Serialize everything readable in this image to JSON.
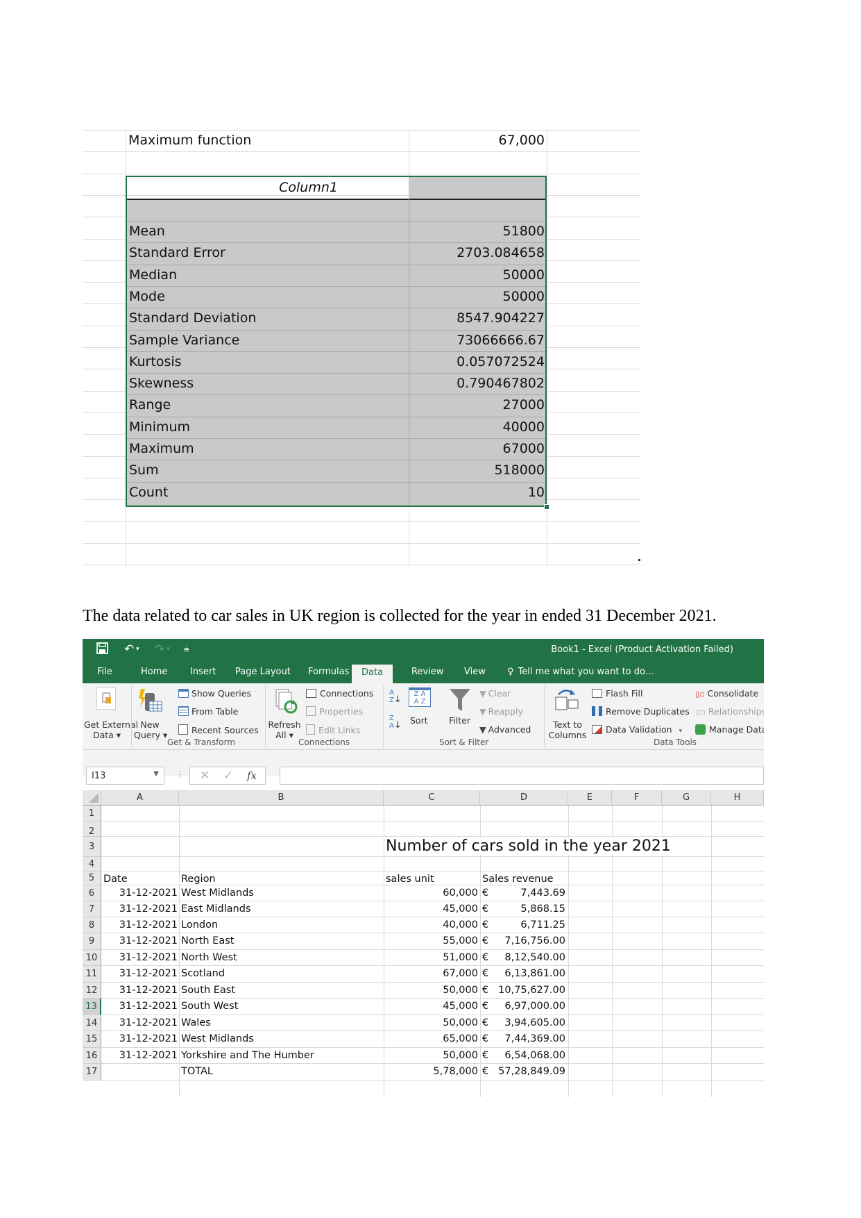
{
  "top_sheet": {
    "max_function": {
      "label": "Maximum function",
      "value": "67,000"
    },
    "stats_header": "Column1",
    "stats": [
      {
        "label": "Mean",
        "value": "51800"
      },
      {
        "label": "Standard Error",
        "value": "2703.084658"
      },
      {
        "label": "Median",
        "value": "50000"
      },
      {
        "label": "Mode",
        "value": "50000"
      },
      {
        "label": "Standard Deviation",
        "value": "8547.904227"
      },
      {
        "label": "Sample Variance",
        "value": "73066666.67"
      },
      {
        "label": "Kurtosis",
        "value": "0.057072524"
      },
      {
        "label": "Skewness",
        "value": "0.790467802"
      },
      {
        "label": "Range",
        "value": "27000"
      },
      {
        "label": "Minimum",
        "value": "40000"
      },
      {
        "label": "Maximum",
        "value": "67000"
      },
      {
        "label": "Sum",
        "value": "518000"
      },
      {
        "label": "Count",
        "value": "10"
      }
    ]
  },
  "caption": "The data related to car sales in UK region is collected for the year in ended 31 December 2021.",
  "excel": {
    "window_title": "Book1 - Excel (Product Activation Failed)",
    "quick_access": {
      "save": "save-icon",
      "undo": "undo-icon",
      "redo": "redo-icon",
      "customize": "customize-icon"
    },
    "tabs": [
      "File",
      "Home",
      "Insert",
      "Page Layout",
      "Formulas",
      "Data",
      "Review",
      "View"
    ],
    "active_tab": "Data",
    "tell_me": "Tell me what you want to do...",
    "ribbon": {
      "get_external_data": [
        "Get External",
        "Data ▾"
      ],
      "new_query": [
        "New",
        "Query ▾"
      ],
      "show_queries": "Show Queries",
      "from_table": "From Table",
      "recent_sources": "Recent Sources",
      "refresh_all": [
        "Refresh",
        "All ▾"
      ],
      "connections": "Connections",
      "properties": "Properties",
      "edit_links": "Edit Links",
      "sort": "Sort",
      "filter": "Filter",
      "clear": "Clear",
      "reapply": "Reapply",
      "advanced": "Advanced",
      "text_to_columns": [
        "Text to",
        "Columns"
      ],
      "flash_fill": "Flash Fill",
      "remove_duplicates": "Remove Duplicates",
      "data_validation": "Data Validation",
      "consolidate": "Consolidate",
      "relationships": "Relationships",
      "manage_data": "Manage Data",
      "groups": [
        "Get & Transform",
        "Connections",
        "Sort & Filter",
        "Data Tools"
      ]
    },
    "name_box": "I13",
    "formula": "",
    "columns": [
      "A",
      "B",
      "C",
      "D",
      "E",
      "F",
      "G",
      "H"
    ],
    "rows": [
      "1",
      "2",
      "3",
      "4",
      "5",
      "6",
      "7",
      "8",
      "9",
      "10",
      "11",
      "12",
      "13",
      "14",
      "15",
      "16",
      "17"
    ],
    "selected_row": "13",
    "sheet_title": "Number of cars sold in the year 2021",
    "headers": {
      "date": "Date",
      "region": "Region",
      "units": "sales unit",
      "revenue": "Sales revenue"
    },
    "currency_symbol": "€",
    "data": [
      {
        "date": "31-12-2021",
        "region": "West Midlands",
        "units": "60,000",
        "revenue": "7,443.69"
      },
      {
        "date": "31-12-2021",
        "region": "East Midlands",
        "units": "45,000",
        "revenue": "5,868.15"
      },
      {
        "date": "31-12-2021",
        "region": "London",
        "units": "40,000",
        "revenue": "6,711.25"
      },
      {
        "date": "31-12-2021",
        "region": "North East",
        "units": "55,000",
        "revenue": "7,16,756.00"
      },
      {
        "date": "31-12-2021",
        "region": "North West",
        "units": "51,000",
        "revenue": "8,12,540.00"
      },
      {
        "date": "31-12-2021",
        "region": "Scotland",
        "units": "67,000",
        "revenue": "6,13,861.00"
      },
      {
        "date": "31-12-2021",
        "region": "South East",
        "units": "50,000",
        "revenue": "10,75,627.00"
      },
      {
        "date": "31-12-2021",
        "region": "South West",
        "units": "45,000",
        "revenue": "6,97,000.00"
      },
      {
        "date": "31-12-2021",
        "region": "Wales",
        "units": "50,000",
        "revenue": "3,94,605.00"
      },
      {
        "date": "31-12-2021",
        "region": "West Midlands",
        "units": "65,000",
        "revenue": "7,44,369.00"
      },
      {
        "date": "31-12-2021",
        "region": "Yorkshire and The Humber",
        "units": "50,000",
        "revenue": "6,54,068.00"
      }
    ],
    "total": {
      "label": "TOTAL",
      "units": "5,78,000",
      "revenue": "57,28,849.09"
    },
    "colors": {
      "excel_green": "#217346",
      "selection_gray": "#c9c9c9"
    }
  }
}
